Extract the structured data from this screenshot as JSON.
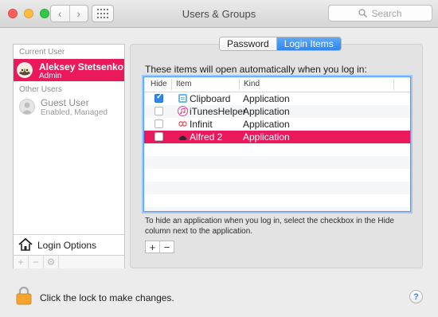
{
  "window": {
    "title": "Users & Groups",
    "search_placeholder": "Search",
    "nav_back": "‹",
    "nav_forward": "›"
  },
  "sidebar": {
    "current_user_section": "Current User",
    "current_user": {
      "name": "Aleksey Stetsenko",
      "role": "Admin"
    },
    "other_users_section": "Other Users",
    "other_users": [
      {
        "name": "Guest User",
        "status": "Enabled, Managed"
      }
    ],
    "login_options_label": "Login Options",
    "tools": [
      "+",
      "−",
      "⚙"
    ]
  },
  "tabs": {
    "password": "Password",
    "login_items": "Login Items",
    "active": "login_items"
  },
  "main": {
    "description": "These items will open automatically when you log in:",
    "columns": [
      "Hide",
      "Item",
      "Kind"
    ],
    "rows": [
      {
        "hide": true,
        "item": "Clipboard",
        "kind": "Application",
        "icon": "clipboard-icon"
      },
      {
        "hide": false,
        "item": "iTunesHelper",
        "kind": "Application",
        "icon": "itunes-icon"
      },
      {
        "hide": false,
        "item": "Infinit",
        "kind": "Application",
        "icon": "infinit-icon"
      },
      {
        "hide": false,
        "item": "Alfred 2",
        "kind": "Application",
        "icon": "alfred-icon",
        "selected": true
      }
    ],
    "hint": "To hide an application when you log in, select the checkbox in the Hide column next to the application.",
    "add_label": "+",
    "remove_label": "−"
  },
  "footer": {
    "lock_text": "Click the lock to make changes.",
    "help_label": "?"
  },
  "colors": {
    "accent": "#e9195b",
    "selection_blue": "#2e86f0",
    "focus_ring": "#4f9bf5"
  }
}
